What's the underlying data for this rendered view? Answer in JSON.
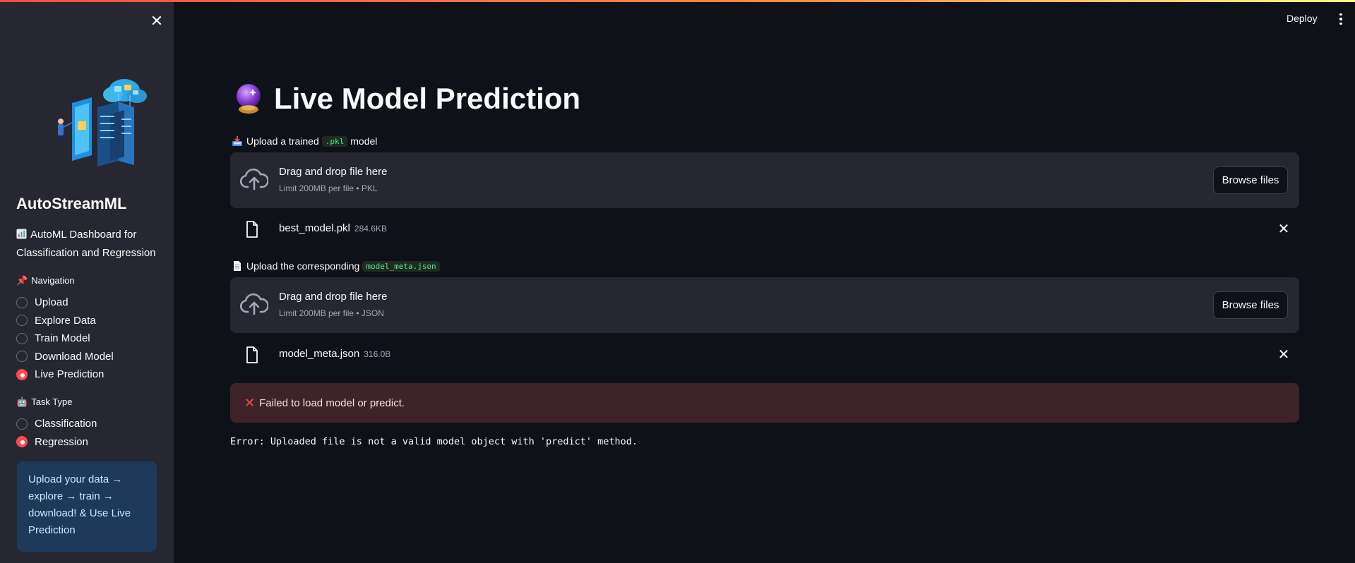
{
  "sidebar": {
    "title": "AutoStreamML",
    "description_icon": "bar-chart-icon",
    "description": "AutoML Dashboard for Classification and Regression",
    "navigation_label": "Navigation",
    "navigation_items": [
      {
        "label": "Upload",
        "selected": false
      },
      {
        "label": "Explore Data",
        "selected": false
      },
      {
        "label": "Train Model",
        "selected": false
      },
      {
        "label": "Download Model",
        "selected": false
      },
      {
        "label": "Live Prediction",
        "selected": true
      }
    ],
    "task_type_label": "Task Type",
    "task_type_items": [
      {
        "label": "Classification",
        "selected": false
      },
      {
        "label": "Regression",
        "selected": true
      }
    ],
    "info_text": "Upload your data → explore → train → download! & Use Live Prediction"
  },
  "header": {
    "deploy_label": "Deploy"
  },
  "main": {
    "title": "Live Model Prediction",
    "title_icon": "crystal-ball-icon",
    "model_upload": {
      "label_prefix": "Upload a trained",
      "label_code": ".pkl",
      "label_suffix": "model",
      "dropzone_title": "Drag and drop file here",
      "dropzone_limit": "Limit 200MB per file • PKL",
      "browse_label": "Browse files",
      "file_name": "best_model.pkl",
      "file_size": "284.6KB"
    },
    "meta_upload": {
      "label_prefix": "Upload the corresponding",
      "label_code": "model_meta.json",
      "dropzone_title": "Drag and drop file here",
      "dropzone_limit": "Limit 200MB per file • JSON",
      "browse_label": "Browse files",
      "file_name": "model_meta.json",
      "file_size": "316.0B"
    },
    "error_message": "Failed to load model or predict.",
    "error_detail": "Error: Uploaded file is not a valid model object with 'predict' method."
  },
  "colors": {
    "accent": "#ff4b4b",
    "background": "#0e1117",
    "sidebar": "#262730",
    "error_bg": "#3e2428",
    "info_bg": "#1d3a5a"
  }
}
